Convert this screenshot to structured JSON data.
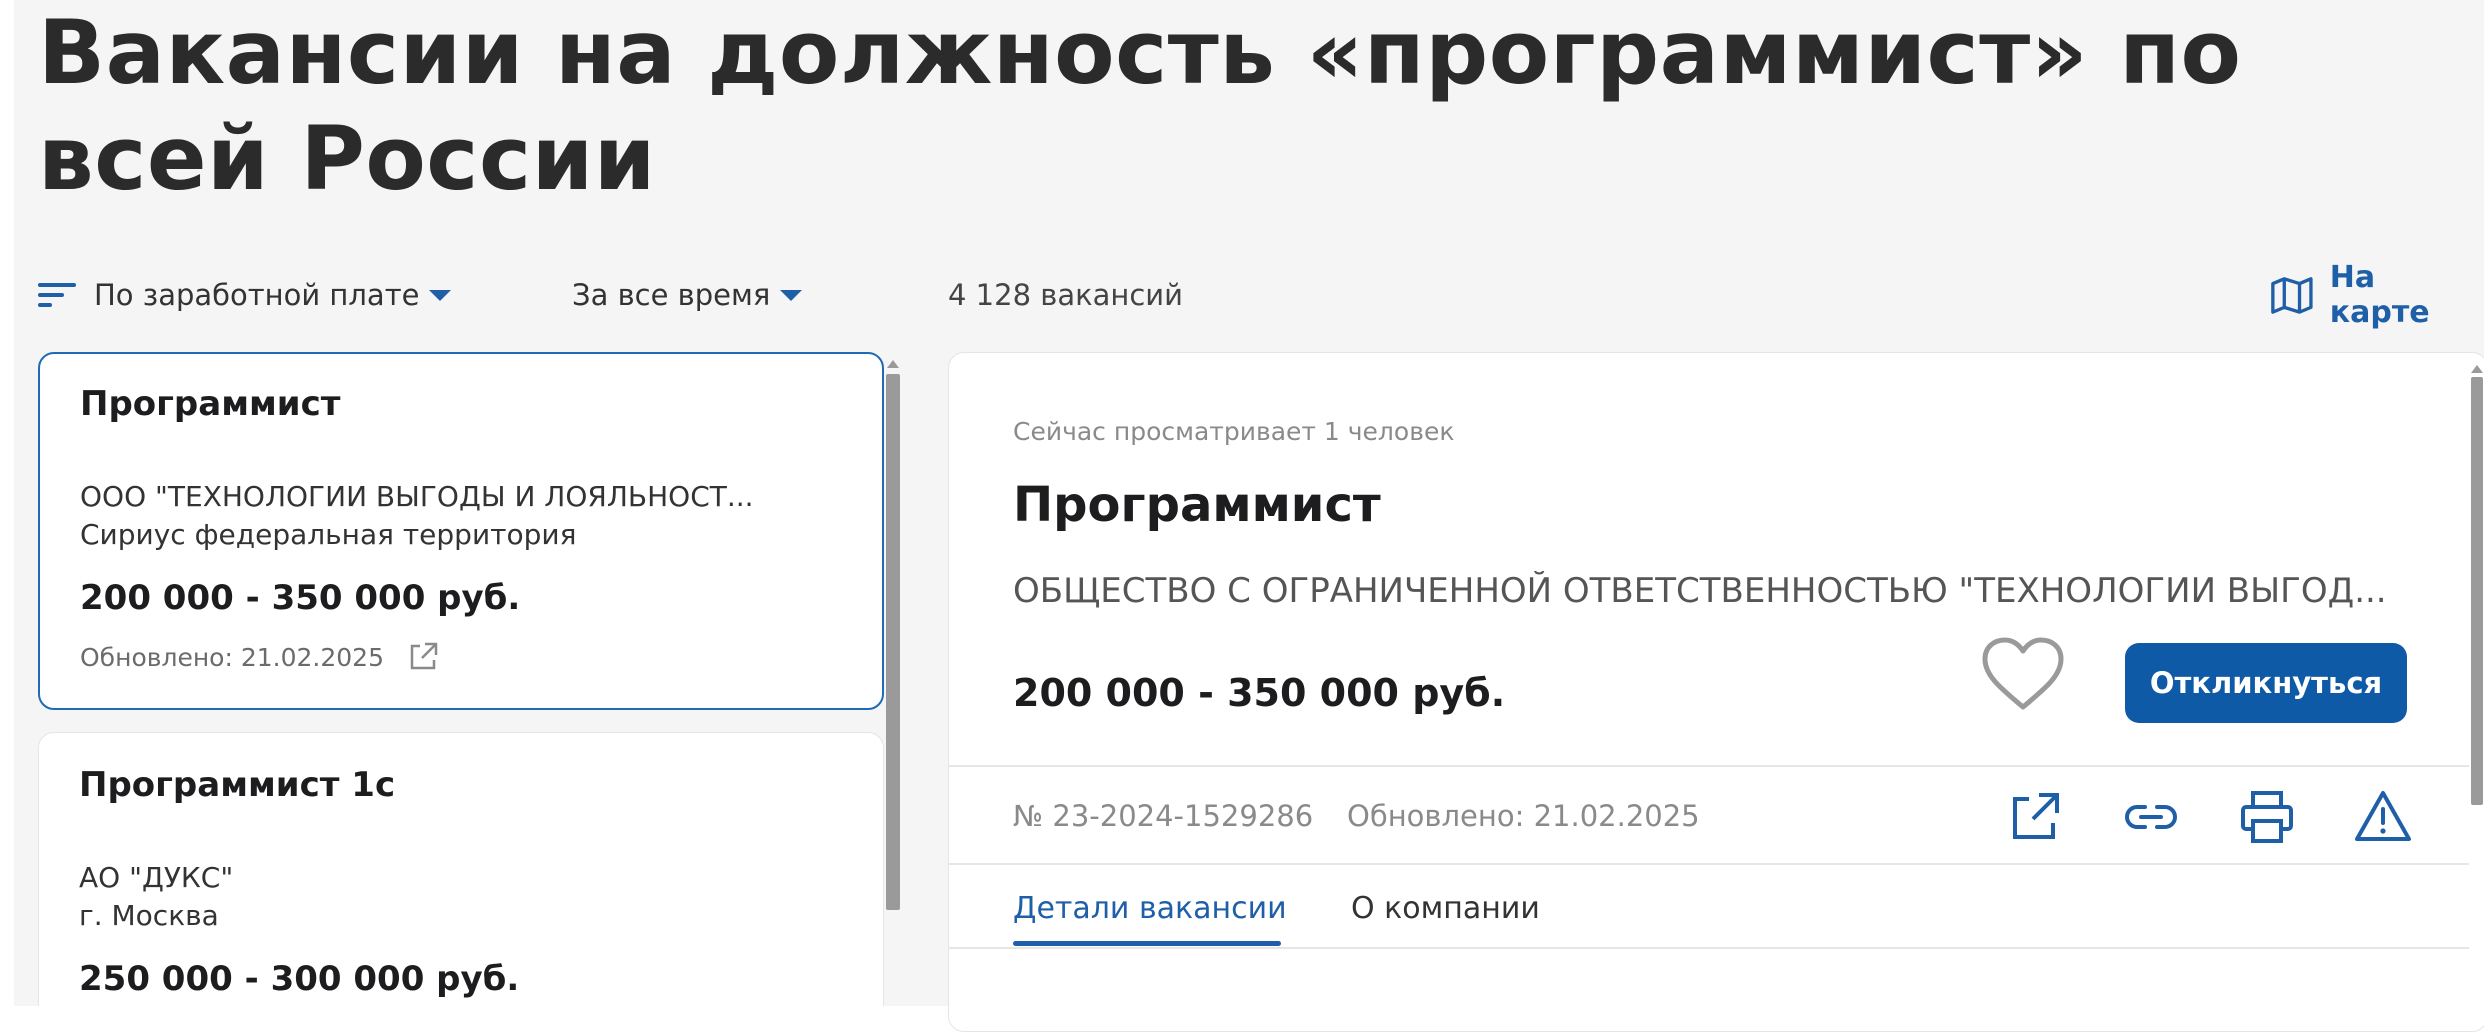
{
  "page": {
    "title": "Вакансии на должность «программист» по всей России"
  },
  "toolbar": {
    "sort_label": "По заработной плате",
    "period_label": "За все время",
    "count_label": "4 128 вакансий",
    "map_label": "На карте"
  },
  "colors": {
    "accent": "#1f5fa8",
    "button": "#0e5aa7",
    "background": "#f5f5f5"
  },
  "vacancies": [
    {
      "title": "Программист",
      "company": "ООО \"ТЕХНОЛОГИИ ВЫГОДЫ И ЛОЯЛЬНОСТ...",
      "location": "Сириус федеральная территория",
      "salary": "200 000 - 350 000 руб.",
      "updated": "Обновлено: 21.02.2025",
      "selected": true
    },
    {
      "title": "Программист 1с",
      "company": "АО \"ДУКС\"",
      "location": "г. Москва",
      "salary": "250 000 - 300 000 руб.",
      "selected": false
    }
  ],
  "detail": {
    "viewers": "Сейчас просматривает 1 человек",
    "title": "Программист",
    "company": "ОБЩЕСТВО С ОГРАНИЧЕННОЙ ОТВЕТСТВЕННОСТЬЮ \"ТЕХНОЛОГИИ ВЫГОД...",
    "salary": "200 000 - 350 000 руб.",
    "apply_label": "Откликнуться",
    "number": "№ 23-2024-1529286",
    "updated": "Обновлено: 21.02.2025",
    "actions": [
      "external-link-icon",
      "copy-link-icon",
      "print-icon",
      "report-warning-icon"
    ],
    "tabs": [
      {
        "label": "Детали вакансии",
        "active": true
      },
      {
        "label": "О компании",
        "active": false
      }
    ]
  }
}
